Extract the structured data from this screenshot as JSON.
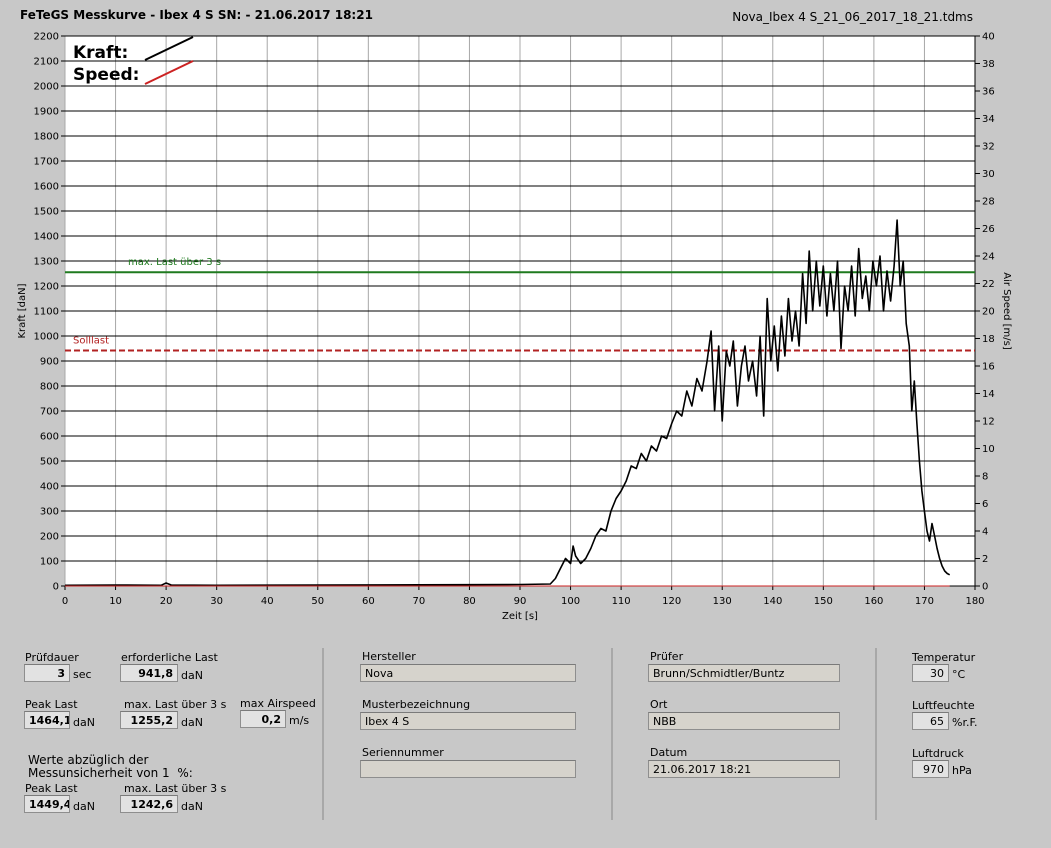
{
  "header": {
    "title": "FeTeGS Messkurve - Ibex 4 S  SN:  - 21.06.2017 18:21",
    "filename": "Nova_Ibex 4 S_21_06_2017_18_21.tdms"
  },
  "chart_data": {
    "type": "line",
    "xlabel": "Zeit [s]",
    "ylabel": "Kraft [daN]",
    "y2label": "Air Speed [m/s]",
    "xlim": [
      0,
      180
    ],
    "ylim": [
      0,
      2200
    ],
    "y2lim": [
      0,
      40
    ],
    "x_ticks": [
      0,
      10,
      20,
      30,
      40,
      50,
      60,
      70,
      80,
      90,
      100,
      110,
      120,
      130,
      140,
      150,
      160,
      170,
      180
    ],
    "y_ticks": [
      0,
      100,
      200,
      300,
      400,
      500,
      600,
      700,
      800,
      900,
      1000,
      1100,
      1200,
      1300,
      1400,
      1500,
      1600,
      1700,
      1800,
      1900,
      2000,
      2100,
      2200
    ],
    "y2_ticks": [
      0,
      2,
      4,
      6,
      8,
      10,
      12,
      14,
      16,
      18,
      20,
      22,
      24,
      26,
      28,
      30,
      32,
      34,
      36,
      38,
      40
    ],
    "grid": true,
    "legend": [
      {
        "label": "Kraft:",
        "color": "#000000"
      },
      {
        "label": "Speed:",
        "color": "#cc2222"
      }
    ],
    "reference_lines": [
      {
        "label": "max. Last über  3 s",
        "value": 1255.2,
        "color": "#1f7a1f",
        "style": "solid"
      },
      {
        "label": "Solllast",
        "value": 941.8,
        "color": "#b22222",
        "style": "dashed"
      }
    ],
    "series": [
      {
        "name": "Kraft",
        "axis": "left",
        "color": "#000000",
        "points": [
          [
            0,
            3
          ],
          [
            10,
            4
          ],
          [
            19,
            3
          ],
          [
            20,
            12
          ],
          [
            21,
            4
          ],
          [
            30,
            3
          ],
          [
            50,
            4
          ],
          [
            70,
            5
          ],
          [
            90,
            6
          ],
          [
            96,
            8
          ],
          [
            97,
            30
          ],
          [
            98,
            70
          ],
          [
            99,
            110
          ],
          [
            100,
            90
          ],
          [
            100.5,
            160
          ],
          [
            101,
            120
          ],
          [
            102,
            90
          ],
          [
            103,
            110
          ],
          [
            104,
            150
          ],
          [
            105,
            200
          ],
          [
            106,
            230
          ],
          [
            107,
            220
          ],
          [
            108,
            300
          ],
          [
            109,
            350
          ],
          [
            110,
            380
          ],
          [
            111,
            420
          ],
          [
            112,
            480
          ],
          [
            113,
            470
          ],
          [
            114,
            530
          ],
          [
            115,
            500
          ],
          [
            116,
            560
          ],
          [
            117,
            540
          ],
          [
            118,
            600
          ],
          [
            119,
            590
          ],
          [
            120,
            650
          ],
          [
            121,
            700
          ],
          [
            122,
            680
          ],
          [
            123,
            780
          ],
          [
            124,
            720
          ],
          [
            125,
            830
          ],
          [
            126,
            780
          ],
          [
            127,
            900
          ],
          [
            127.8,
            1020
          ],
          [
            128.5,
            700
          ],
          [
            129.3,
            960
          ],
          [
            130,
            660
          ],
          [
            130.8,
            940
          ],
          [
            131.5,
            880
          ],
          [
            132.2,
            980
          ],
          [
            133,
            720
          ],
          [
            133.8,
            880
          ],
          [
            134.5,
            960
          ],
          [
            135.2,
            820
          ],
          [
            136,
            900
          ],
          [
            136.8,
            760
          ],
          [
            137.5,
            1000
          ],
          [
            138.2,
            680
          ],
          [
            138.9,
            1150
          ],
          [
            139.6,
            900
          ],
          [
            140.3,
            1040
          ],
          [
            141,
            860
          ],
          [
            141.7,
            1080
          ],
          [
            142.4,
            920
          ],
          [
            143.1,
            1150
          ],
          [
            143.8,
            980
          ],
          [
            144.5,
            1100
          ],
          [
            145.2,
            960
          ],
          [
            145.9,
            1250
          ],
          [
            146.6,
            1050
          ],
          [
            147.2,
            1340
          ],
          [
            147.9,
            1100
          ],
          [
            148.6,
            1300
          ],
          [
            149.3,
            1120
          ],
          [
            150,
            1280
          ],
          [
            150.7,
            1080
          ],
          [
            151.4,
            1250
          ],
          [
            152.1,
            1100
          ],
          [
            152.8,
            1300
          ],
          [
            153.5,
            950
          ],
          [
            154.2,
            1200
          ],
          [
            154.9,
            1100
          ],
          [
            155.6,
            1280
          ],
          [
            156.3,
            1080
          ],
          [
            157,
            1350
          ],
          [
            157.7,
            1150
          ],
          [
            158.4,
            1240
          ],
          [
            159.1,
            1100
          ],
          [
            159.8,
            1300
          ],
          [
            160.5,
            1200
          ],
          [
            161.2,
            1320
          ],
          [
            161.9,
            1100
          ],
          [
            162.6,
            1260
          ],
          [
            163.3,
            1140
          ],
          [
            164,
            1280
          ],
          [
            164.6,
            1464
          ],
          [
            165.2,
            1200
          ],
          [
            165.8,
            1300
          ],
          [
            166.4,
            1050
          ],
          [
            167,
            960
          ],
          [
            167.5,
            700
          ],
          [
            168,
            820
          ],
          [
            168.5,
            650
          ],
          [
            169,
            500
          ],
          [
            169.5,
            380
          ],
          [
            170,
            300
          ],
          [
            170.5,
            220
          ],
          [
            171,
            180
          ],
          [
            171.5,
            250
          ],
          [
            172,
            200
          ],
          [
            172.5,
            150
          ],
          [
            173,
            110
          ],
          [
            173.5,
            80
          ],
          [
            174,
            60
          ],
          [
            174.5,
            50
          ],
          [
            175,
            45
          ]
        ]
      },
      {
        "name": "Speed",
        "axis": "right",
        "color": "#cc2222",
        "points": [
          [
            0,
            0
          ],
          [
            175,
            0
          ]
        ]
      }
    ]
  },
  "info": {
    "pruefdauer": {
      "label": "Prüfdauer",
      "value": "3",
      "unit": "sec"
    },
    "erforderliche_last": {
      "label": "erforderliche Last",
      "value": "941,8",
      "unit": "daN"
    },
    "peak_last": {
      "label": "Peak Last",
      "value": "1464,1",
      "unit": "daN"
    },
    "max_last": {
      "label": "max. Last über  3 s",
      "value": "1255,2",
      "unit": "daN"
    },
    "max_airspeed": {
      "label": "max Airspeed",
      "value": "0,2",
      "unit": "m/s"
    },
    "werte_note": "Werte abzüglich der\nMessunsicherheit von 1  %:",
    "peak_last_2": {
      "label": "Peak Last",
      "value": "1449,4",
      "unit": "daN"
    },
    "max_last_2": {
      "label": "max. Last über  3 s",
      "value": "1242,6",
      "unit": "daN"
    },
    "hersteller": {
      "label": "Hersteller",
      "value": "Nova"
    },
    "musterbezeichnung": {
      "label": "Musterbezeichnung",
      "value": "Ibex 4 S"
    },
    "seriennummer": {
      "label": "Seriennummer",
      "value": ""
    },
    "pruefer": {
      "label": "Prüfer",
      "value": "Brunn/Schmidtler/Buntz"
    },
    "ort": {
      "label": "Ort",
      "value": "NBB"
    },
    "datum": {
      "label": "Datum",
      "value": "21.06.2017 18:21"
    },
    "temperatur": {
      "label": "Temperatur",
      "value": "30",
      "unit": "°C"
    },
    "luftfeuchte": {
      "label": "Luftfeuchte",
      "value": "65",
      "unit": "%r.F."
    },
    "luftdruck": {
      "label": "Luftdruck",
      "value": "970",
      "unit": "hPa"
    }
  }
}
